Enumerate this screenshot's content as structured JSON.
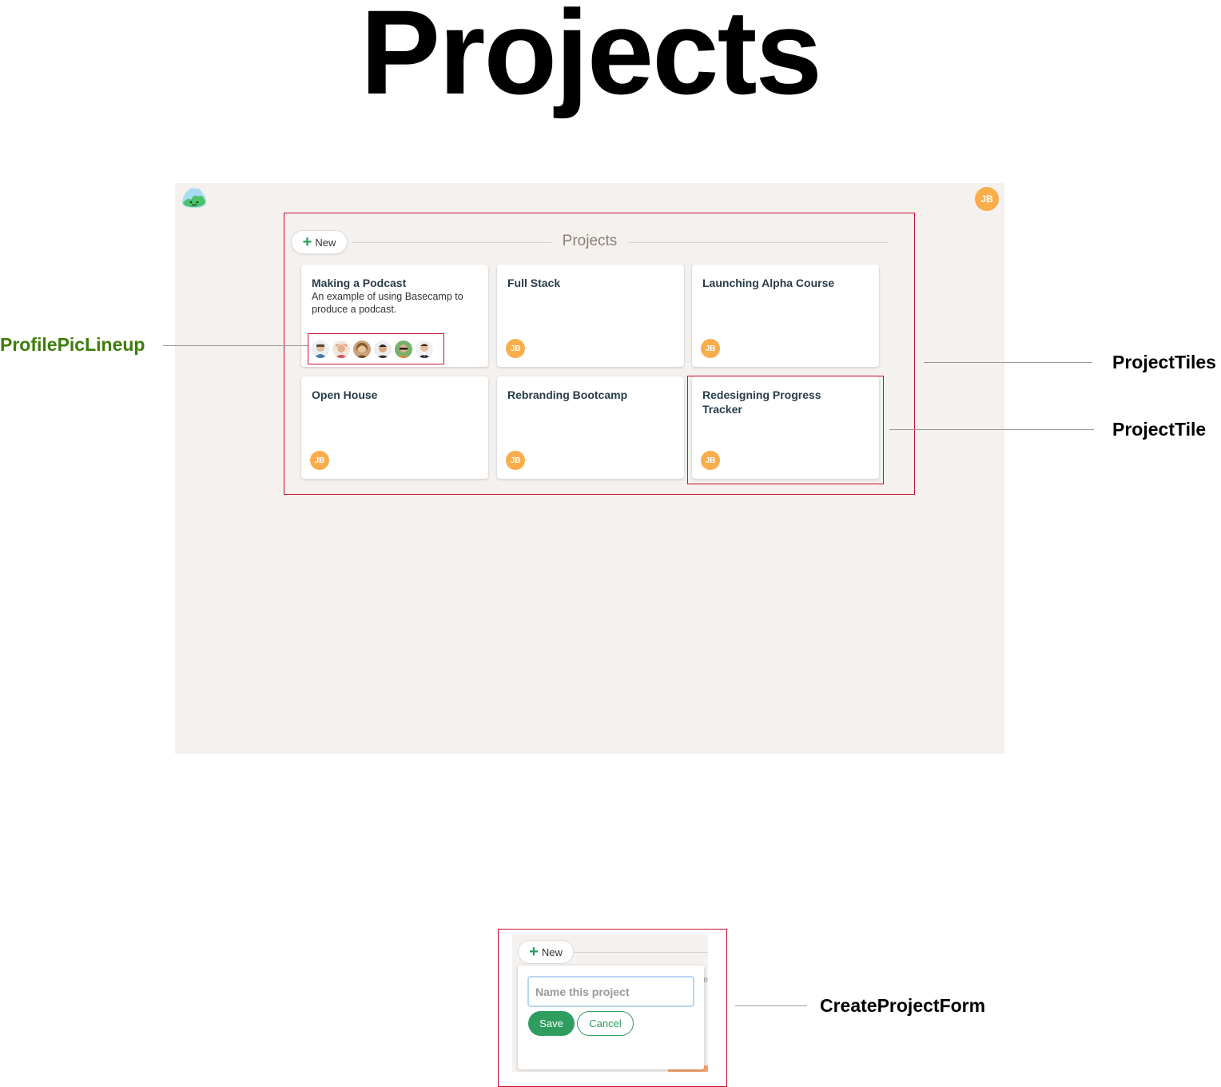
{
  "heading": "Projects",
  "app": {
    "header": {
      "avatar_initials": "JB",
      "logo_icon": "basecamp-logo-icon"
    },
    "section": {
      "new_button_icon": "+",
      "new_button_label": "New",
      "title": "Projects"
    },
    "projects": [
      {
        "title": "Making a Podcast",
        "description": "An example of using Basecamp to produce a podcast.",
        "members": [
          "person-1",
          "person-2",
          "person-3",
          "person-4",
          "person-5",
          "person-6"
        ]
      },
      {
        "title": "Full Stack",
        "description": "",
        "avatar": "JB"
      },
      {
        "title": "Launching Alpha Course",
        "description": "",
        "avatar": "JB"
      },
      {
        "title": "Open House",
        "description": "",
        "avatar": "JB"
      },
      {
        "title": "Rebranding Bootcamp",
        "description": "",
        "avatar": "JB"
      },
      {
        "title": "Redesigning Progress Tracker",
        "description": "",
        "avatar": "JB"
      }
    ],
    "colors": {
      "background": "#f4f1ee",
      "accent": "#2e9d5f",
      "avatar": "#f9ad4b",
      "annotation_box": "#c8102e"
    }
  },
  "annotations": {
    "profile_pic_lineup": "ProfilePicLineup",
    "project_tiles": "ProjectTiles",
    "project_tile": "ProjectTile",
    "create_project_form": "CreateProjectForm"
  },
  "create_form": {
    "new_button_icon": "+",
    "new_button_label": "New",
    "input_placeholder": "Name this project",
    "save_label": "Save",
    "cancel_label": "Cancel"
  }
}
